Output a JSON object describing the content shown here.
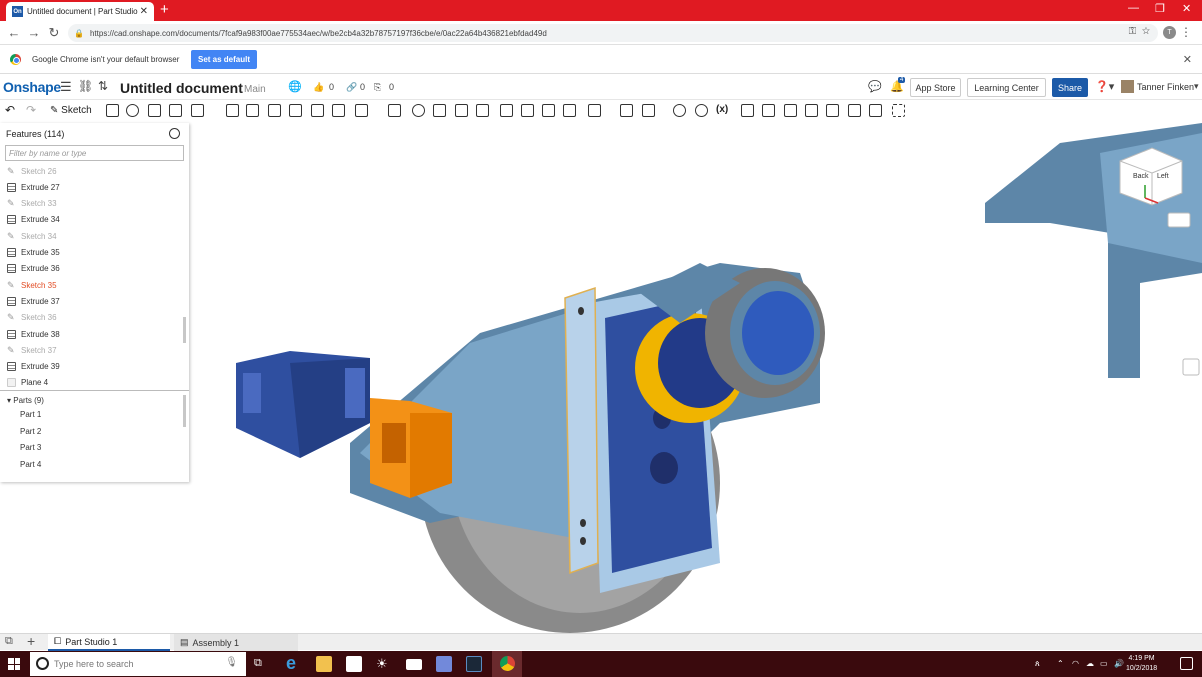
{
  "browser": {
    "tab_title": "Untitled document | Part Studio 1",
    "favicon_label": "On",
    "url": "https://cad.onshape.com/documents/7fcaf9a983f00ae775534aec/w/be2cb4a32b78757197f36cbe/e/0ac22a64b436821ebfdad49d",
    "profile_initial": "T"
  },
  "infobar": {
    "message": "Google Chrome isn't your default browser",
    "button": "Set as default"
  },
  "header": {
    "logo": "Onshape",
    "doc_title": "Untitled document",
    "branch": "Main",
    "likes": "0",
    "links": "0",
    "copies": "0",
    "notif_count": "4",
    "app_store": "App Store",
    "learning_center": "Learning Center",
    "share": "Share",
    "user": "Tanner Finken"
  },
  "toolbar": {
    "sketch": "Sketch",
    "variable_label": "(x)"
  },
  "features": {
    "title": "Features (114)",
    "filter_placeholder": "Filter by name or type",
    "items": [
      {
        "label": "Sketch 26",
        "kind": "sketch"
      },
      {
        "label": "Extrude 27",
        "kind": "extrude"
      },
      {
        "label": "Sketch 33",
        "kind": "sketch"
      },
      {
        "label": "Extrude 34",
        "kind": "extrude"
      },
      {
        "label": "Sketch 34",
        "kind": "sketch"
      },
      {
        "label": "Extrude 35",
        "kind": "extrude"
      },
      {
        "label": "Extrude 36",
        "kind": "extrude"
      },
      {
        "label": "Sketch 35",
        "kind": "sketch-active"
      },
      {
        "label": "Extrude 37",
        "kind": "extrude"
      },
      {
        "label": "Sketch 36",
        "kind": "sketch"
      },
      {
        "label": "Extrude 38",
        "kind": "extrude"
      },
      {
        "label": "Sketch 37",
        "kind": "sketch"
      },
      {
        "label": "Extrude 39",
        "kind": "extrude"
      },
      {
        "label": "Plane 4",
        "kind": "plane"
      }
    ]
  },
  "parts": {
    "title": "Parts (9)",
    "items": [
      "Part 1",
      "Part 2",
      "Part 3",
      "Part 4"
    ]
  },
  "viewcube": {
    "back": "Back",
    "left": "Left"
  },
  "tabs": {
    "part_studio": "Part Studio 1",
    "assembly": "Assembly 1"
  },
  "taskbar": {
    "search_placeholder": "Type here to search",
    "time": "4:19 PM",
    "date": "10/2/2018"
  },
  "colors": {
    "chrome_red": "#e01a22",
    "onshape_blue": "#1c5aa8",
    "active_feature": "#e24c24",
    "part_steel": "#5d86a8",
    "part_blue": "#2f4fa0",
    "part_orange": "#f39116",
    "part_gold": "#f0b400",
    "part_gray": "#8a8a8a"
  }
}
